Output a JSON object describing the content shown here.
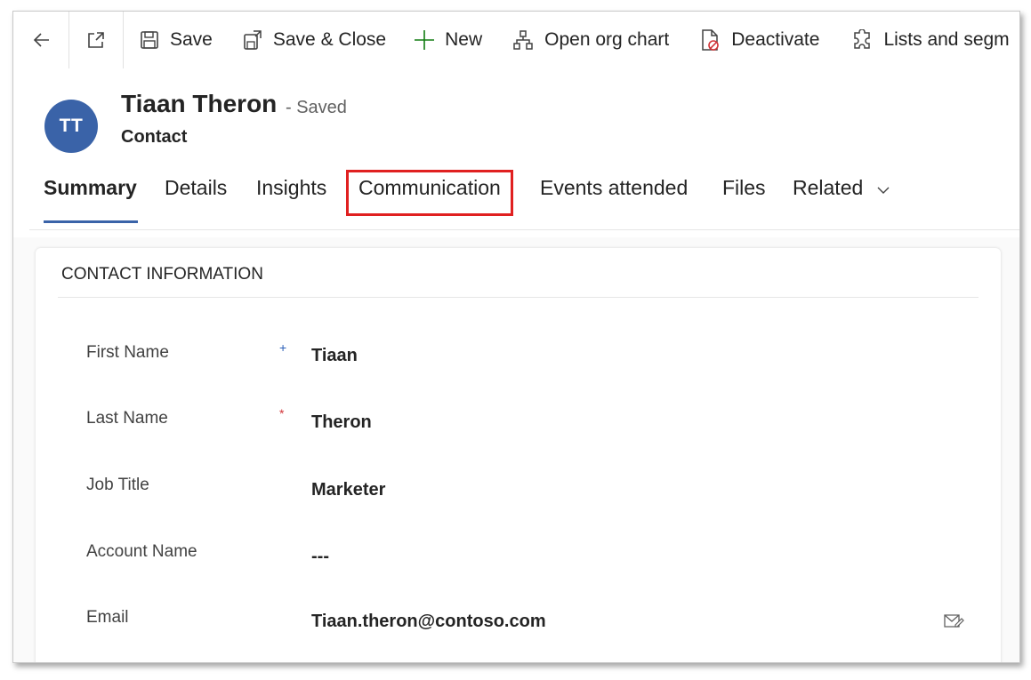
{
  "toolbar": {
    "save": "Save",
    "save_close": "Save & Close",
    "new": "New",
    "open_org_chart": "Open org chart",
    "deactivate": "Deactivate",
    "lists": "Lists and segm"
  },
  "header": {
    "avatar_initials": "TT",
    "name": "Tiaan Theron",
    "status": "- Saved",
    "entity": "Contact"
  },
  "tabs": [
    {
      "label": "Summary"
    },
    {
      "label": "Details"
    },
    {
      "label": "Insights"
    },
    {
      "label": "Communication"
    },
    {
      "label": "Events attended"
    },
    {
      "label": "Files"
    },
    {
      "label": "Related"
    }
  ],
  "section": {
    "title": "CONTACT INFORMATION",
    "fields": [
      {
        "label": "First Name",
        "value": "Tiaan",
        "requirement": "+"
      },
      {
        "label": "Last Name",
        "value": "Theron",
        "requirement": "*"
      },
      {
        "label": "Job Title",
        "value": "Marketer"
      },
      {
        "label": "Account Name",
        "value": "---"
      },
      {
        "label": "Email",
        "value": "Tiaan.theron@contoso.com"
      }
    ]
  },
  "colors": {
    "accent": "#3a63a8",
    "highlight": "#e02020",
    "required": "#d13438",
    "recommended": "#2b5fb8",
    "new_icon": "#107c10"
  }
}
